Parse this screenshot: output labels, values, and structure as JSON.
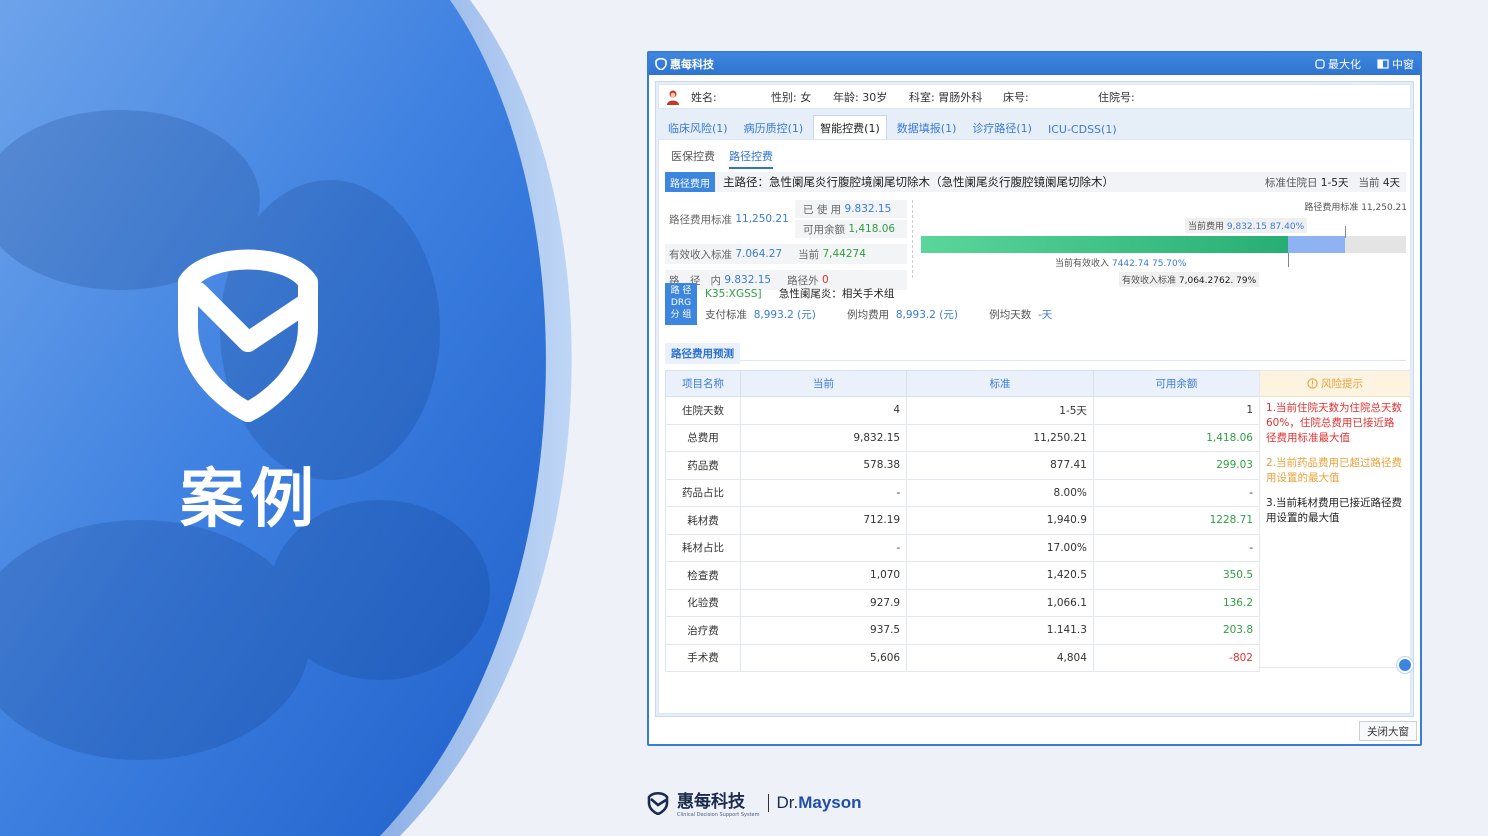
{
  "hero": {
    "title": "案例"
  },
  "window": {
    "brand": "惠每科技",
    "maximize_label": "最大化",
    "medium_label": "中窗",
    "close_label": "关闭大窗"
  },
  "patient": {
    "name_label": "姓名:",
    "gender_label": "性别: 女",
    "age_label": "年龄: 30岁",
    "dept_label": "科室: 胃肠外科",
    "bed_label": "床号:",
    "admission_label": "住院号:"
  },
  "tabs": [
    "临床风险(1)",
    "病历质控(1)",
    "智能控费(1)",
    "数据填报(1)",
    "诊疗路径(1)",
    "ICU-CDSS(1)"
  ],
  "subtabs": [
    "医保控费",
    "路径控费"
  ],
  "path": {
    "tag": "路径费用",
    "main": "主路径：急性阑尾炎行腹腔境阑尾切除木（急性阑尾炎行腹腔镜阑尾切除木）",
    "std_label": "标准住院日",
    "std_value": "1-5天",
    "cur_label": "当前",
    "cur_value": "4天"
  },
  "summary": {
    "std_fee_label": "路径费用标准",
    "std_fee": "11,250.21",
    "used_label": "已 使 用",
    "used": "9.832.15",
    "avail_label": "可用余额",
    "avail": "1,418.06",
    "eff_income_label": "有效收入标准",
    "eff_income": "7.064.27",
    "current_label": "当前",
    "current": "7,44274",
    "path_label": "路　径",
    "in_label": "内",
    "in_value": "9.832.15",
    "out_label": "路径外",
    "out_value": "0"
  },
  "bar_labels": {
    "std": "路径费用标准 11,250.21",
    "cur_fee_label": "当前费用",
    "cur_fee": "9,832.15 87.40%",
    "eff_cur_label": "当前有效收入",
    "eff_cur": "7442.74 75.70%",
    "eff_std_label": "有效收入标准",
    "eff_std": "7,064.2762. 79%"
  },
  "bar_values": {
    "current_fraction": 0.874,
    "effective_fraction": 0.757
  },
  "drg": {
    "tag_lines": [
      "路 径",
      "DRG",
      "分 组"
    ],
    "code": "K35:XGSS]",
    "group": "急性阑尾炎：相关手术组",
    "pay_label": "支付标准",
    "pay_value": "8,993.2 (元)",
    "avg_label": "例均费用",
    "avg_value": "8,993.2 (元)",
    "days_label": "例均天数",
    "days_value": "-天"
  },
  "predict_title": "路径费用预测",
  "table": {
    "headers": [
      "项目名称",
      "当前",
      "标准",
      "可用余额"
    ],
    "rows": [
      [
        "住院天数",
        "4",
        "1-5天",
        "1"
      ],
      [
        "总费用",
        "9,832.15",
        "11,250.21",
        "1,418.06"
      ],
      [
        "药品费",
        "578.38",
        "877.41",
        "299.03"
      ],
      [
        "药品占比",
        "-",
        "8.00%",
        "-"
      ],
      [
        "耗材费",
        "712.19",
        "1,940.9",
        "1228.71"
      ],
      [
        "耗材占比",
        "-",
        "17.00%",
        "-"
      ],
      [
        "检查费",
        "1,070",
        "1,420.5",
        "350.5"
      ],
      [
        "化验费",
        "927.9",
        "1,066.1",
        "136.2"
      ],
      [
        "治疗费",
        "937.5",
        "1.141.3",
        "203.8"
      ],
      [
        "手术费",
        "5,606",
        "4,804",
        "-802"
      ]
    ]
  },
  "risk": {
    "title": "风险提示",
    "items": [
      "1.当前住院天数为住院总天数60%，住院总费用已接近路径费用标准最大值",
      "2.当前药品费用已超过路径费用设置的最大值",
      "3.当前耗材费用已接近路径费用设置的最大值"
    ]
  },
  "footer": {
    "brand": "惠每科技",
    "subtitle": "Clinical Decision Support System",
    "dr": "Dr.",
    "mayson": "Mayson"
  },
  "colors": {
    "accent": "#3a7bd5",
    "hero_blue": "#2f6fd6",
    "green": "#2f9e44",
    "red": "#e03131",
    "warning": "#e8a13a"
  }
}
